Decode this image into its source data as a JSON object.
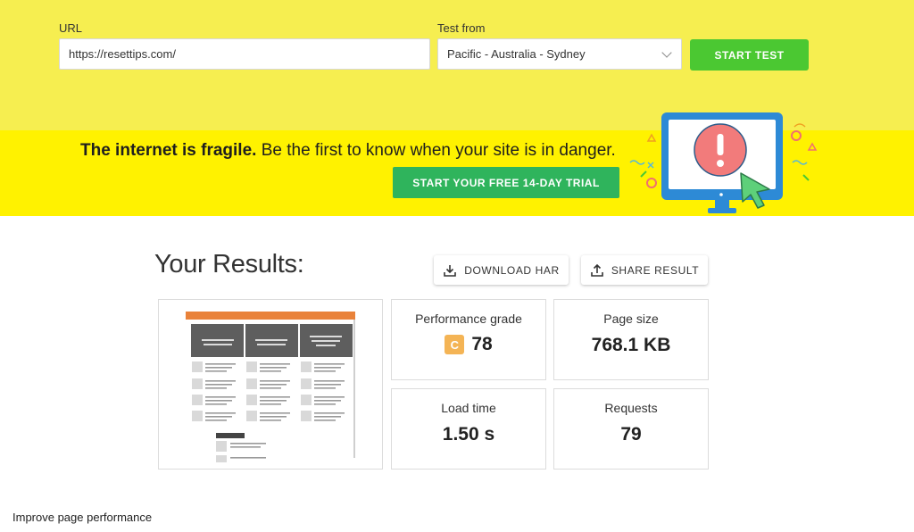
{
  "form": {
    "url_label": "URL",
    "url_value": "https://resettips.com/",
    "test_from_label": "Test from",
    "test_from_value": "Pacific - Australia - Sydney",
    "start_label": "START TEST"
  },
  "promo": {
    "bold": "The internet is fragile.",
    "rest": " Be the first to know when your site is in danger.",
    "trial_label": "START YOUR FREE 14-DAY TRIAL"
  },
  "results": {
    "title": "Your Results:",
    "download_label": "DOWNLOAD HAR",
    "share_label": "SHARE RESULT",
    "performance_label": "Performance grade",
    "grade_letter": "C",
    "grade_value": "78",
    "page_size_label": "Page size",
    "page_size_value": "768.1 KB",
    "load_time_label": "Load time",
    "load_time_value": "1.50 s",
    "requests_label": "Requests",
    "requests_value": "79"
  },
  "improve_label": "Improve page performance",
  "colors": {
    "top_band": "#f6ee50",
    "promo_band": "#fff200",
    "start_button": "#4bc832",
    "trial_button": "#2fb45c",
    "grade_badge": "#f4b455"
  },
  "icons": [
    "chevron-down-icon",
    "download-icon",
    "share-icon",
    "alert-monitor-illustration"
  ]
}
